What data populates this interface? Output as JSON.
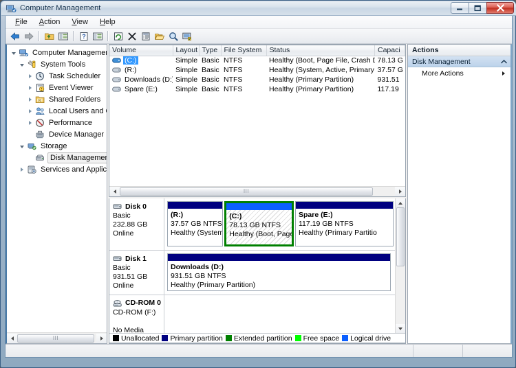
{
  "window": {
    "title": "Computer Management",
    "icon": "computer-management-icon",
    "buttons": {
      "minimize": "minimize-icon",
      "maximize": "maximize-icon",
      "close": "close-icon"
    }
  },
  "menubar": {
    "items": [
      {
        "label": "File",
        "accel": "F"
      },
      {
        "label": "Action",
        "accel": "A"
      },
      {
        "label": "View",
        "accel": "V"
      },
      {
        "label": "Help",
        "accel": "H"
      }
    ]
  },
  "toolbar": {
    "buttons": [
      {
        "name": "back-icon",
        "tip": "Back"
      },
      {
        "name": "forward-icon",
        "tip": "Forward"
      },
      {
        "name": "up-folder-icon",
        "tip": "Up One Level"
      },
      {
        "name": "show-hide-tree-icon",
        "tip": "Show/Hide Console Tree"
      },
      {
        "name": "help-icon",
        "tip": "Help"
      },
      {
        "name": "properties-list-icon",
        "tip": "Properties"
      },
      {
        "name": "refresh-icon",
        "tip": "Refresh"
      },
      {
        "name": "delete-icon",
        "tip": "Delete"
      },
      {
        "name": "properties-icon",
        "tip": "Properties"
      },
      {
        "name": "open-folder-icon",
        "tip": "Open"
      },
      {
        "name": "search-icon",
        "tip": "Find"
      },
      {
        "name": "rescan-disks-icon",
        "tip": "Rescan Disks"
      }
    ]
  },
  "sidebar": {
    "nodes": [
      {
        "label": "Computer Management (Local",
        "indent": 0,
        "expander": "open",
        "icon": "computer-icon",
        "selected": false
      },
      {
        "label": "System Tools",
        "indent": 1,
        "expander": "open",
        "icon": "system-tools-icon",
        "selected": false
      },
      {
        "label": "Task Scheduler",
        "indent": 2,
        "expander": "closed",
        "icon": "clock-icon",
        "selected": false
      },
      {
        "label": "Event Viewer",
        "indent": 2,
        "expander": "closed",
        "icon": "event-viewer-icon",
        "selected": false
      },
      {
        "label": "Shared Folders",
        "indent": 2,
        "expander": "closed",
        "icon": "shared-folders-icon",
        "selected": false
      },
      {
        "label": "Local Users and Groups",
        "indent": 2,
        "expander": "closed",
        "icon": "users-icon",
        "selected": false
      },
      {
        "label": "Performance",
        "indent": 2,
        "expander": "closed",
        "icon": "performance-icon",
        "selected": false
      },
      {
        "label": "Device Manager",
        "indent": 2,
        "expander": "none",
        "icon": "device-manager-icon",
        "selected": false
      },
      {
        "label": "Storage",
        "indent": 1,
        "expander": "open",
        "icon": "storage-icon",
        "selected": false
      },
      {
        "label": "Disk Management",
        "indent": 2,
        "expander": "none",
        "icon": "disk-management-icon",
        "selected": true
      },
      {
        "label": "Services and Applications",
        "indent": 1,
        "expander": "closed",
        "icon": "services-icon",
        "selected": false
      }
    ]
  },
  "volume_list": {
    "columns": [
      "Volume",
      "Layout",
      "Type",
      "File System",
      "Status",
      "Capaci"
    ],
    "rows": [
      {
        "volume": "(C:)",
        "icon": "volume-drive-icon-active",
        "selected": true,
        "layout": "Simple",
        "type": "Basic",
        "filesystem": "NTFS",
        "status": "Healthy (Boot, Page File, Crash Dump, Logical Drive)",
        "capacity": "78.13 G"
      },
      {
        "volume": "(R:)",
        "icon": "volume-drive-icon",
        "selected": false,
        "layout": "Simple",
        "type": "Basic",
        "filesystem": "NTFS",
        "status": "Healthy (System, Active, Primary Partition)",
        "capacity": "37.57 G"
      },
      {
        "volume": "Downloads (D:)",
        "icon": "volume-drive-icon",
        "selected": false,
        "layout": "Simple",
        "type": "Basic",
        "filesystem": "NTFS",
        "status": "Healthy (Primary Partition)",
        "capacity": "931.51"
      },
      {
        "volume": "Spare (E:)",
        "icon": "volume-drive-icon",
        "selected": false,
        "layout": "Simple",
        "type": "Basic",
        "filesystem": "NTFS",
        "status": "Healthy (Primary Partition)",
        "capacity": "117.19"
      }
    ]
  },
  "disk_panel": {
    "disks": [
      {
        "name": "Disk 0",
        "icon": "disk-icon",
        "kind": "Basic",
        "size": "232.88 GB",
        "state": "Online",
        "partitions": [
          {
            "title": "(R:)",
            "size": "37.57 GB NTFS",
            "status": "Healthy (System, Activ",
            "selected": false,
            "bar_color": "#000080",
            "width_pct": 25
          },
          {
            "title": "(C:)",
            "size": "78.13 GB NTFS",
            "status": "Healthy (Boot, Page Fi",
            "selected": true,
            "bar_color": "#0b5fff",
            "width_pct": 31
          },
          {
            "title": "Spare  (E:)",
            "size": "117.19 GB NTFS",
            "status": "Healthy (Primary Partitio",
            "selected": false,
            "bar_color": "#000080",
            "width_pct": 44
          }
        ]
      },
      {
        "name": "Disk 1",
        "icon": "disk-icon",
        "kind": "Basic",
        "size": "931.51 GB",
        "state": "Online",
        "partitions": [
          {
            "title": "Downloads  (D:)",
            "size": "931.51 GB NTFS",
            "status": "Healthy (Primary Partition)",
            "selected": false,
            "bar_color": "#000080",
            "width_pct": 100
          }
        ]
      },
      {
        "name": "CD-ROM 0",
        "icon": "cdrom-icon",
        "kind": "CD-ROM (F:)",
        "size": "",
        "state": "No Media",
        "partitions": []
      }
    ],
    "legend": [
      {
        "label": "Unallocated",
        "color": "#000000"
      },
      {
        "label": "Primary partition",
        "color": "#000080"
      },
      {
        "label": "Extended partition",
        "color": "#008000"
      },
      {
        "label": "Free space",
        "color": "#00ff00"
      },
      {
        "label": "Logical drive",
        "color": "#0b5fff"
      }
    ]
  },
  "actions": {
    "header": "Actions",
    "group": {
      "label": "Disk Management",
      "collapse_icon": "chevron-up-icon"
    },
    "items": [
      {
        "label": "More Actions",
        "submenu_icon": "chevron-right-icon"
      }
    ]
  },
  "statusbar": {
    "text": ""
  },
  "colors": {
    "accent": "#3399ff",
    "selected_partition_border": "#008000",
    "primary_partition": "#000080",
    "logical_drive": "#0b5fff",
    "free_space": "#00ff00",
    "titlebar_close": "#c02f20"
  }
}
